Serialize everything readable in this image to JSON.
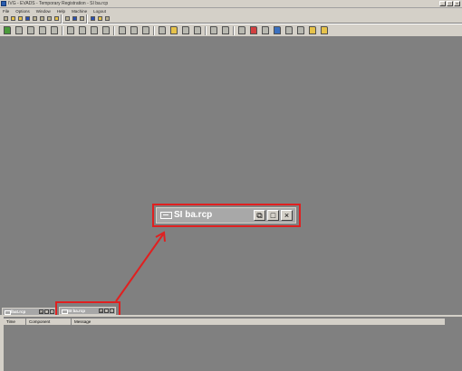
{
  "window": {
    "title": "IVG - EVADS - Temporary Registration - SI ba.rcp",
    "controls": [
      "_",
      "□",
      "×"
    ]
  },
  "menu": [
    "File",
    "Options",
    "Window",
    "Help",
    "Machine",
    "Logout"
  ],
  "mdi": {
    "minimized_windows": [
      {
        "label": "lbat.rcp"
      },
      {
        "label": "SI ba.rcp"
      }
    ],
    "zoom_window": {
      "label": "SI ba.rcp"
    }
  },
  "log_panel": {
    "columns": [
      "Time",
      "Component",
      "Message"
    ]
  },
  "colors": {
    "highlight": "#e02020",
    "workspace": "#808080",
    "chrome": "#d4d0c8"
  }
}
